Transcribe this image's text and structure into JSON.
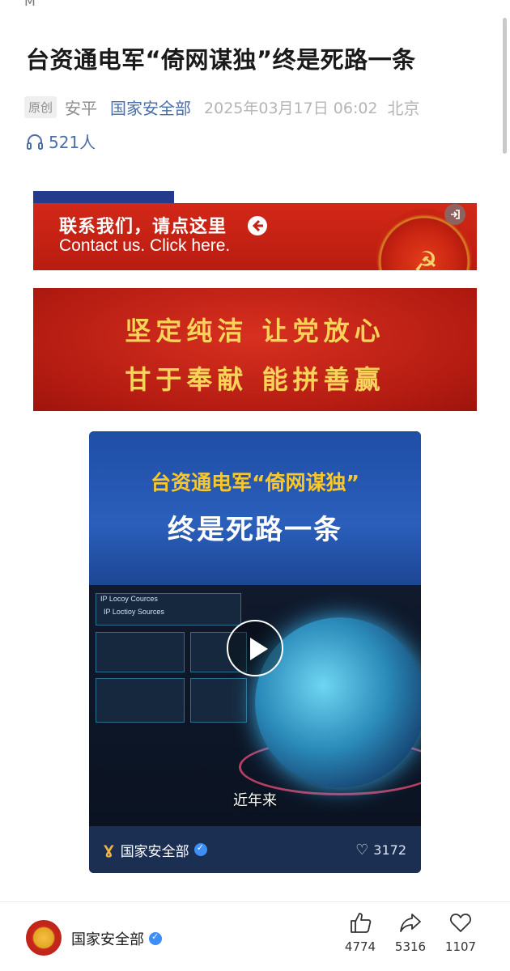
{
  "status_fragment": "M",
  "article": {
    "title": "台资通电军“倚网谋独”终是死路一条",
    "badge": "原创",
    "author": "安平",
    "source": "国家安全部",
    "date": "2025年03月17日 06:02",
    "location": "北京",
    "listeners": "521人"
  },
  "banner_contact": {
    "cn": "联系我们，请点这里",
    "en": "Contact us. Click here."
  },
  "banner_slogan": {
    "line1": "坚定纯洁 让党放心",
    "line2": "甘于奉献 能拼善赢"
  },
  "video": {
    "subtitle": "台资通电军“倚网谋独”",
    "main_title": "终是死路一条",
    "screen_label_1": "IP Locoy Cources",
    "screen_label_2": "IP Loctioy Sources",
    "caption": "近年来",
    "account": "国家安全部",
    "likes": "3172"
  },
  "footer": {
    "account": "国家安全部",
    "like_count": "4774",
    "share_count": "5316",
    "favorite_count": "1107"
  },
  "colors": {
    "link_blue": "#4a6ea8",
    "banner_red": "#c22314",
    "slogan_gold": "#f7d35a",
    "video_title_yellow": "#f7c72c"
  }
}
